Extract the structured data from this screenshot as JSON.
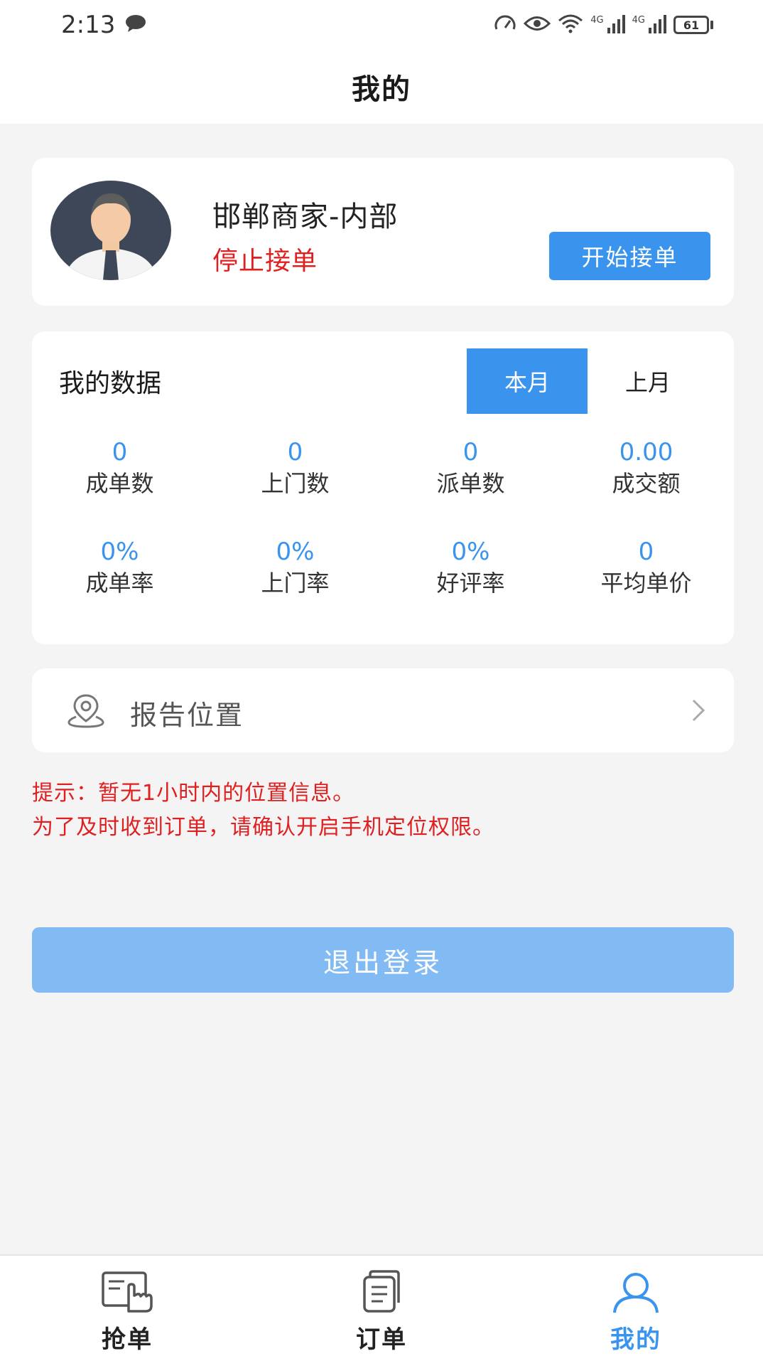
{
  "status_bar": {
    "time": "2:13",
    "network_label_1": "4G",
    "network_label_2": "4G",
    "battery": "61"
  },
  "header": {
    "title": "我的"
  },
  "profile": {
    "name": "邯郸商家-内部",
    "status": "停止接单",
    "start_button": "开始接单"
  },
  "data_section": {
    "title": "我的数据",
    "tabs": [
      {
        "label": "本月",
        "active": true
      },
      {
        "label": "上月",
        "active": false
      }
    ],
    "stats": [
      {
        "value": "0",
        "label": "成单数"
      },
      {
        "value": "0",
        "label": "上门数"
      },
      {
        "value": "0",
        "label": "派单数"
      },
      {
        "value": "0.00",
        "label": "成交额"
      },
      {
        "value": "0%",
        "label": "成单率"
      },
      {
        "value": "0%",
        "label": "上门率"
      },
      {
        "value": "0%",
        "label": "好评率"
      },
      {
        "value": "0",
        "label": "平均单价"
      }
    ]
  },
  "location": {
    "label": "报告位置"
  },
  "tip": {
    "line1": "提示：暂无1小时内的位置信息。",
    "line2": "为了及时收到订单，请确认开启手机定位权限。"
  },
  "logout": {
    "label": "退出登录"
  },
  "nav": {
    "items": [
      {
        "label": "抢单",
        "icon": "grab-order-icon"
      },
      {
        "label": "订单",
        "icon": "order-list-icon"
      },
      {
        "label": "我的",
        "icon": "profile-icon"
      }
    ]
  },
  "colors": {
    "accent": "#3a94ee",
    "logout_bg": "#82bbf4",
    "alert": "#e02020",
    "background": "#f4f4f4"
  }
}
